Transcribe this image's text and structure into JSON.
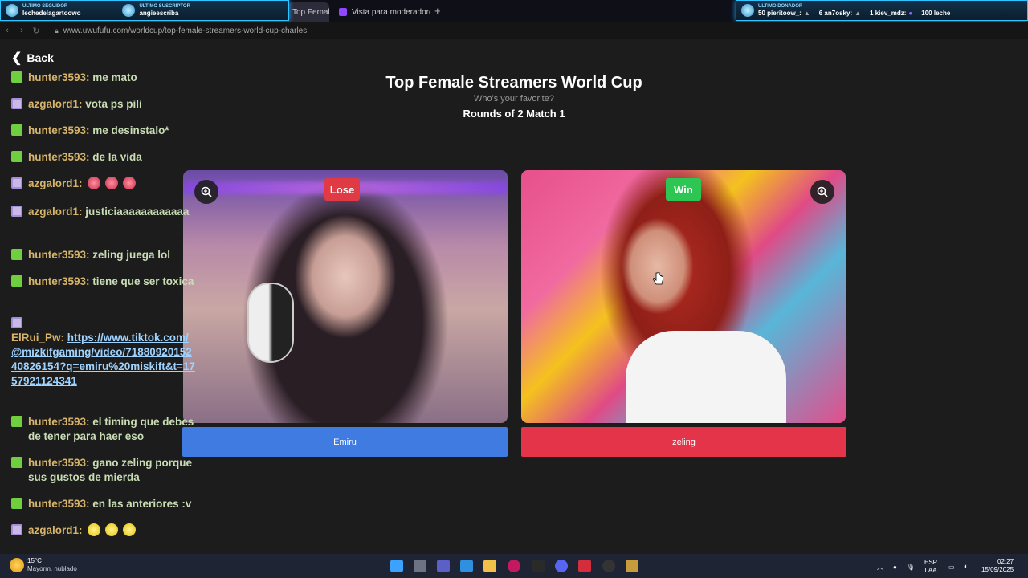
{
  "browser": {
    "tabs": [
      {
        "label": "Top Female Streamers W"
      },
      {
        "label": "Vista para moderadores o"
      }
    ],
    "new_tab": "+",
    "url": "www.uwufufu.com/worldcup/top-female-streamers-world-cup-charles"
  },
  "overlay": {
    "follower_caption": "ULTIMO SEGUIDOR",
    "follower_name": "lechedelagartoowo",
    "subscriber_caption": "ULTIMO SUSCRIPTOR",
    "subscriber_name": "angieescriba",
    "donor_caption": "ULTIMO DONADOR",
    "donors": [
      {
        "amount": "50",
        "name": "pieritoow_:"
      },
      {
        "amount": "6",
        "name": "an7osky:"
      },
      {
        "amount": "1",
        "name": "kiev_mdz:"
      },
      {
        "amount": "100",
        "name": "leche"
      }
    ]
  },
  "page": {
    "back_label": "Back",
    "title": "Top Female Streamers World Cup",
    "subtitle": "Who's your favorite?",
    "round": "Rounds of 2 Match 1",
    "left": {
      "badge": "Lose",
      "name": "Emiru"
    },
    "right": {
      "badge": "Win",
      "name": "zeling"
    }
  },
  "chat": [
    {
      "user": "hunter3593",
      "text": "me mato",
      "icon": "green"
    },
    {
      "user": "azgalord1",
      "text": "vota ps pili",
      "icon": "purple"
    },
    {
      "user": "hunter3593",
      "text": "me desinstalo*",
      "icon": "green"
    },
    {
      "user": "hunter3593",
      "text": "de la vida",
      "icon": "green"
    },
    {
      "user": "azgalord1",
      "text": "",
      "icon": "purple",
      "emotes": "flame"
    },
    {
      "user": "azgalord1",
      "text": "justiciaaaaaaaaaaaa",
      "icon": "purple"
    },
    {
      "user": "hunter3593",
      "text": "zeling juega lol",
      "icon": "green"
    },
    {
      "user": "hunter3593",
      "text": "tiene que ser toxica",
      "icon": "green"
    },
    {
      "user": "ElRui_Pw",
      "text": "https://www.tiktok.com/@mizkifgaming/video/7188092015240826154?q=emiru%20miskift&t=1757921124341",
      "icon": "purple",
      "is_link": true
    },
    {
      "user": "hunter3593",
      "text": "el timing que debes de tener para haer eso",
      "icon": "green"
    },
    {
      "user": "hunter3593",
      "text": "gano zeling porque sus gustos de mierda",
      "icon": "green"
    },
    {
      "user": "hunter3593",
      "text": "en las anteriores :v",
      "icon": "green"
    },
    {
      "user": "azgalord1",
      "text": "",
      "icon": "purple",
      "emotes": "duck"
    }
  ],
  "taskbar": {
    "temperature": "15°C",
    "condition": "Mayorm. nublado",
    "lang_top": "ESP",
    "lang_bottom": "LAA",
    "time": "02:27",
    "date": "15/09/2025"
  }
}
